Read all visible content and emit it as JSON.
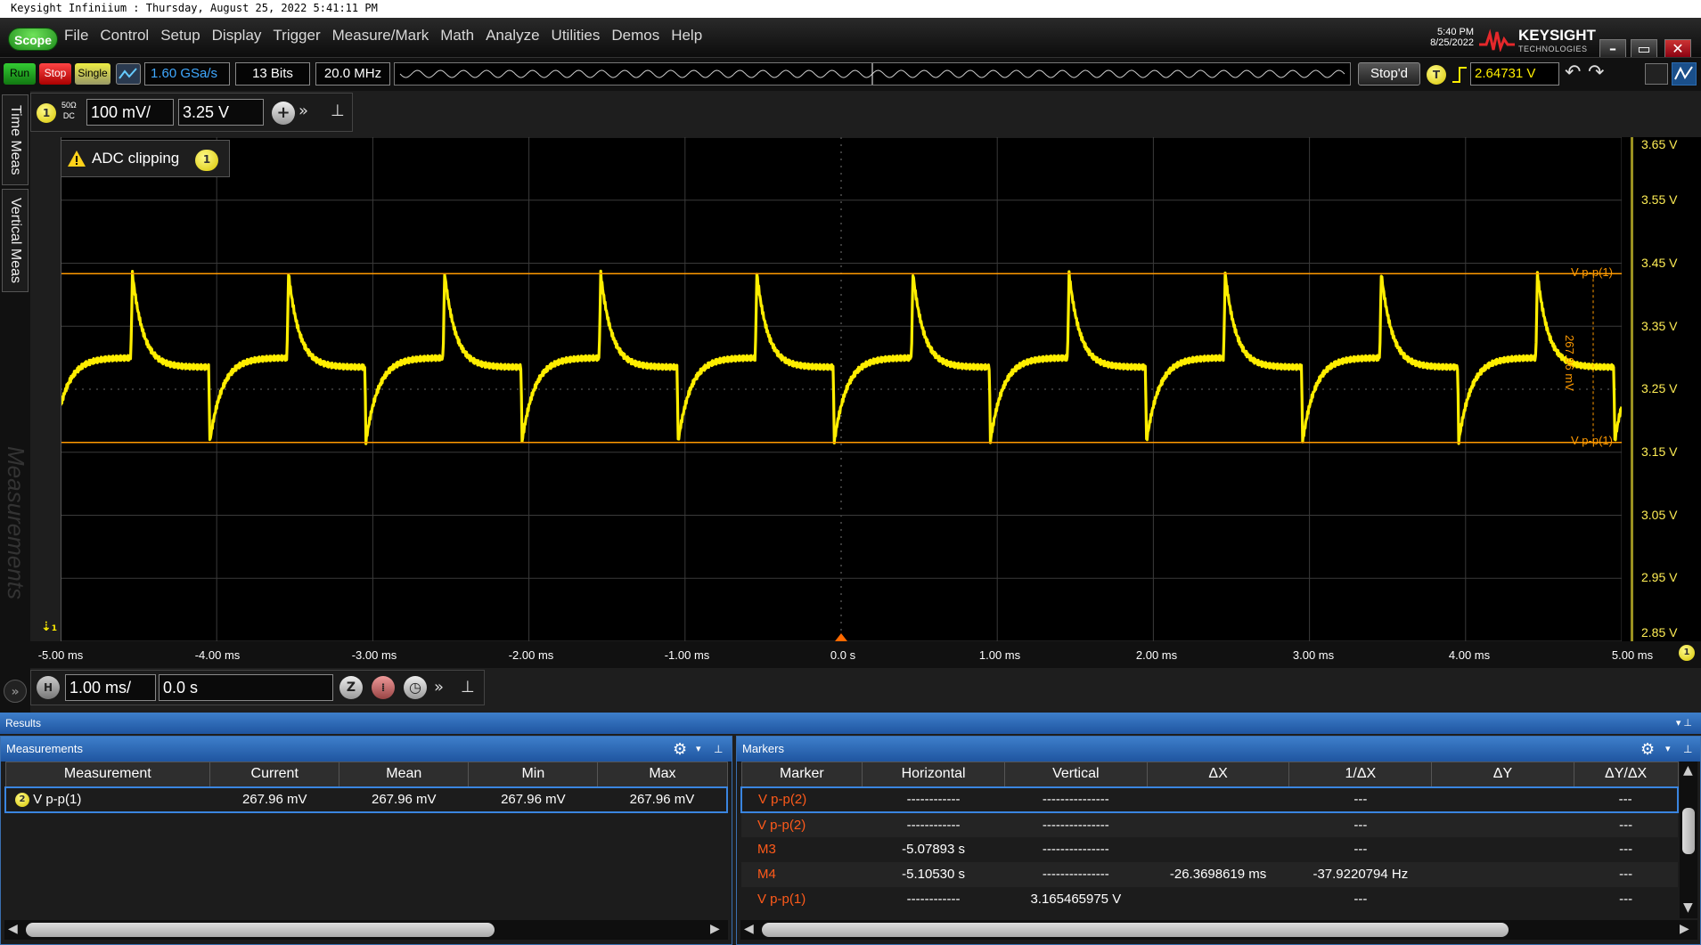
{
  "window_title": "Keysight Infiniium : Thursday, August 25, 2022 5:41:11 PM",
  "menubar": {
    "scope_label": "Scope",
    "items": [
      "File",
      "Control",
      "Setup",
      "Display",
      "Trigger",
      "Measure/Mark",
      "Math",
      "Analyze",
      "Utilities",
      "Demos",
      "Help"
    ],
    "time": "5:40 PM",
    "date": "8/25/2022",
    "brand": "KEYSIGHT",
    "brand_sub": "TECHNOLOGIES"
  },
  "toolbar": {
    "run_label": "Run",
    "stop_label": "Stop",
    "single_label": "Single",
    "sample_rate": "1.60 GSa/s",
    "bits": "13 Bits",
    "bandwidth": "20.0 MHz",
    "status": "Stop'd",
    "trigger_badge": "T",
    "trigger_level": "2.64731 V"
  },
  "sidebar": {
    "tabs": [
      "Time Meas",
      "Vertical Meas"
    ],
    "ghost_label": "Measurements"
  },
  "channel": {
    "number": "1",
    "coupling_top": "50Ω",
    "coupling_bottom": "DC",
    "scale": "100 mV/",
    "offset": "3.25 V"
  },
  "adc_warning": {
    "text": "ADC clipping",
    "channel": "1"
  },
  "plot": {
    "y_labels": [
      "3.65 V",
      "3.55 V",
      "3.45 V",
      "3.35 V",
      "3.25 V",
      "3.15 V",
      "3.05 V",
      "2.95 V",
      "2.85 V"
    ],
    "x_labels": [
      "-5.00 ms",
      "-4.00 ms",
      "-3.00 ms",
      "-2.00 ms",
      "-1.00 ms",
      "0.0 s",
      "1.00 ms",
      "2.00 ms",
      "3.00 ms",
      "4.00 ms",
      "5.00 ms"
    ],
    "marker_top_label": "V p-p(1)",
    "marker_bottom_label": "V p-p(1)",
    "marker_delta_label": "267.96 mV",
    "ground_marker": "1",
    "right_channel_badge": "1",
    "colors": {
      "trace": "#ffee00",
      "marker": "#ff9a00"
    }
  },
  "chart_data": {
    "type": "line",
    "title": "",
    "xlabel": "",
    "ylabel": "",
    "xlim": [
      -5.0,
      5.0
    ],
    "ylim": [
      2.85,
      3.65
    ],
    "x_unit": "ms",
    "y_unit": "V",
    "period_ms": 1.0,
    "series": [
      {
        "x": [
          -5.0,
          -4.55,
          -4.45,
          -4.0,
          -3.55,
          -3.45,
          -3.0,
          -2.55,
          -2.45,
          -2.0,
          -1.55,
          -1.45,
          -1.0,
          -0.55,
          -0.45,
          0.0,
          0.45,
          0.55,
          1.0,
          1.45,
          1.55,
          2.0,
          2.45,
          2.55,
          3.0,
          3.45,
          3.55,
          4.0,
          4.45,
          4.55,
          5.0
        ],
        "y": [
          3.25,
          3.3,
          3.43,
          3.28,
          3.3,
          3.43,
          3.28,
          3.3,
          3.43,
          3.28,
          3.3,
          3.43,
          3.28,
          3.3,
          3.43,
          3.28,
          3.3,
          3.43,
          3.28,
          3.3,
          3.43,
          3.28,
          3.3,
          3.43,
          3.28,
          3.3,
          3.43,
          3.28,
          3.3,
          3.43,
          3.25
        ]
      }
    ],
    "markers": {
      "vpp_top": 3.4334,
      "vpp_bottom": 3.1655,
      "vpp": 0.26796
    },
    "grid": true
  },
  "horizontal": {
    "badge": "H",
    "scale": "1.00 ms/",
    "position": "0.0 s"
  },
  "results": {
    "bar_label": "Results",
    "measurements": {
      "title": "Measurements",
      "columns": [
        "Measurement",
        "Current",
        "Mean",
        "Min",
        "Max"
      ],
      "rows": [
        {
          "badge": "2",
          "name": "V p-p(1)",
          "current": "267.96 mV",
          "mean": "267.96 mV",
          "min": "267.96 mV",
          "max": "267.96 mV"
        }
      ]
    },
    "markers": {
      "title": "Markers",
      "columns": [
        "Marker",
        "Horizontal",
        "Vertical",
        "ΔX",
        "1/ΔX",
        "ΔY",
        "ΔY/ΔX"
      ],
      "rows": [
        {
          "marker": "V p-p(2)",
          "horizontal": "------------",
          "vertical": "---------------",
          "dx": "",
          "inv_dx": "---",
          "dy": "",
          "dydx": "---"
        },
        {
          "marker": "V p-p(2)",
          "horizontal": "------------",
          "vertical": "---------------",
          "dx": "",
          "inv_dx": "---",
          "dy": "",
          "dydx": "---"
        },
        {
          "marker": "M3",
          "horizontal": "-5.07893 s",
          "vertical": "---------------",
          "dx": "",
          "inv_dx": "---",
          "dy": "",
          "dydx": "---"
        },
        {
          "marker": "M4",
          "horizontal": "-5.10530 s",
          "vertical": "---------------",
          "dx": "-26.3698619 ms",
          "inv_dx": "-37.9220794 Hz",
          "dy": "",
          "dydx": "---"
        },
        {
          "marker": "V p-p(1)",
          "horizontal": "------------",
          "vertical": "3.165465975 V",
          "dx": "",
          "inv_dx": "---",
          "dy": "",
          "dydx": "---"
        }
      ]
    }
  }
}
